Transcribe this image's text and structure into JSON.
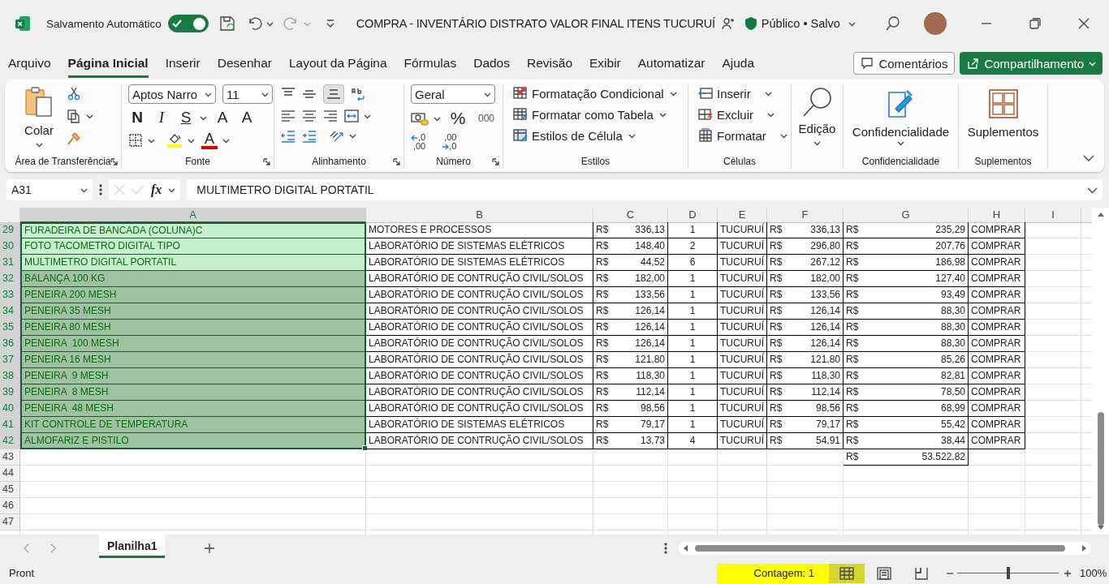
{
  "title_bar": {
    "autosave_label": "Salvamento Automático",
    "autosave_on": true,
    "redo_disabled": true,
    "title": "COMPRA - INVENTÁRIO DISTRATO VALOR FINAL ITENS TUCURUÍ",
    "status": "Público • Salvo"
  },
  "tabs": [
    {
      "label": "Arquivo",
      "selected": false
    },
    {
      "label": "Página Inicial",
      "selected": true
    },
    {
      "label": "Inserir",
      "selected": false
    },
    {
      "label": "Desenhar",
      "selected": false
    },
    {
      "label": "Layout da Página",
      "selected": false
    },
    {
      "label": "Fórmulas",
      "selected": false
    },
    {
      "label": "Dados",
      "selected": false
    },
    {
      "label": "Revisão",
      "selected": false
    },
    {
      "label": "Exibir",
      "selected": false
    },
    {
      "label": "Automatizar",
      "selected": false
    },
    {
      "label": "Ajuda",
      "selected": false
    }
  ],
  "comments_button": "Comentários",
  "share_button": "Compartilhamento",
  "ribbon": {
    "groups": [
      {
        "kind": "clipboard",
        "label": "Área de Transferência",
        "paste": "Colar"
      },
      {
        "kind": "font",
        "label": "Fonte",
        "font_name": "Aptos Narro",
        "font_size": "11",
        "bold": "N",
        "italic": "I",
        "underline": "S",
        "grow": "A",
        "shrink": "A",
        "font_color": "A"
      },
      {
        "kind": "alignment",
        "label": "Alinhamento"
      },
      {
        "kind": "number",
        "label": "Número",
        "format": "Geral",
        "percent": "%",
        "thousands": "000",
        "add_decimal": [
          ",0",
          ",00"
        ],
        "remove_decimal": [
          ",00",
          ",0"
        ]
      },
      {
        "kind": "styles",
        "label": "Estilos",
        "items": [
          "Formatação Condicional",
          "Formatar como Tabela",
          "Estilos de Célula"
        ]
      },
      {
        "kind": "cells",
        "label": "Células",
        "items": [
          "Inserir",
          "Excluir",
          "Formatar"
        ]
      },
      {
        "kind": "editing",
        "button": "Edição"
      },
      {
        "kind": "sensitivity",
        "label": "Confidencialidade",
        "button": "Confidencialidade"
      },
      {
        "kind": "addins",
        "label": "Suplementos",
        "button": "Suplementos"
      }
    ]
  },
  "formula_bar": {
    "name_box": "A31",
    "fx": "fx",
    "formula": "MULTIMETRO DIGITAL PORTATIL"
  },
  "sheet": {
    "columns": [
      {
        "label": "A",
        "selected": true
      },
      {
        "label": "B",
        "selected": false
      },
      {
        "label": "C",
        "selected": false
      },
      {
        "label": "D",
        "selected": false
      },
      {
        "label": "E",
        "selected": false
      },
      {
        "label": "F",
        "selected": false
      },
      {
        "label": "G",
        "selected": false
      },
      {
        "label": "H",
        "selected": false
      },
      {
        "label": "I",
        "selected": false
      }
    ],
    "rows": [
      {
        "number": "29",
        "selected": true,
        "cells": [
          {
            "text": "FURADEIRA DE BANCADA (COLUNA)C",
            "color": "#c6efce"
          },
          {
            "text": "MOTORES E PROCESSOS"
          },
          {
            "currency": "R$",
            "amount": "336,13"
          },
          {
            "text": "1"
          },
          {
            "text": "TUCURUÍ"
          },
          {
            "currency": "R$",
            "amount": "336,13"
          },
          {
            "currency": "R$",
            "amount": "235,29"
          },
          {
            "text": "COMPRAR"
          }
        ]
      },
      {
        "number": "30",
        "selected": true,
        "cells": [
          {
            "text": "FOTO TACOMETRO DIGITAL TIPO",
            "color": "#c6efce"
          },
          {
            "text": "LABORATÓRIO DE SISTEMAS ELÉTRICOS"
          },
          {
            "currency": "R$",
            "amount": "148,40"
          },
          {
            "text": "2"
          },
          {
            "text": "TUCURUÍ"
          },
          {
            "currency": "R$",
            "amount": "296,80"
          },
          {
            "currency": "R$",
            "amount": "207,76"
          },
          {
            "text": "COMPRAR"
          }
        ]
      },
      {
        "number": "31",
        "selected": true,
        "cells": [
          {
            "text": "MULTIMETRO DIGITAL PORTATIL",
            "color": "#c6efce"
          },
          {
            "text": "LABORATÓRIO DE SISTEMAS ELÉTRICOS"
          },
          {
            "currency": "R$",
            "amount": "44,52"
          },
          {
            "text": "6"
          },
          {
            "text": "TUCURUÍ"
          },
          {
            "currency": "R$",
            "amount": "267,12"
          },
          {
            "currency": "R$",
            "amount": "186,98"
          },
          {
            "text": "COMPRAR"
          }
        ]
      },
      {
        "number": "32",
        "selected": true,
        "cells": [
          {
            "text": "BALANÇA 100 KG",
            "color": "#9fc2a2"
          },
          {
            "text": "LABORATÓRIO DE CONTRUÇÃO CIVIL/SOLOS"
          },
          {
            "currency": "R$",
            "amount": "182,00"
          },
          {
            "text": "1"
          },
          {
            "text": "TUCURUÍ"
          },
          {
            "currency": "R$",
            "amount": "182,00"
          },
          {
            "currency": "R$",
            "amount": "127,40"
          },
          {
            "text": "COMPRAR"
          }
        ]
      },
      {
        "number": "33",
        "selected": true,
        "cells": [
          {
            "text": "PENEIRA 200 MESH",
            "color": "#9fc2a2"
          },
          {
            "text": "LABORATÓRIO DE CONTRUÇÃO CIVIL/SOLOS"
          },
          {
            "currency": "R$",
            "amount": "133,56"
          },
          {
            "text": "1"
          },
          {
            "text": "TUCURUÍ"
          },
          {
            "currency": "R$",
            "amount": "133,56"
          },
          {
            "currency": "R$",
            "amount": "93,49"
          },
          {
            "text": "COMPRAR"
          }
        ]
      },
      {
        "number": "34",
        "selected": true,
        "cells": [
          {
            "text": "PENEIRA 35 MESH",
            "color": "#9fc2a2"
          },
          {
            "text": "LABORATÓRIO DE CONTRUÇÃO CIVIL/SOLOS"
          },
          {
            "currency": "R$",
            "amount": "126,14"
          },
          {
            "text": "1"
          },
          {
            "text": "TUCURUÍ"
          },
          {
            "currency": "R$",
            "amount": "126,14"
          },
          {
            "currency": "R$",
            "amount": "88,30"
          },
          {
            "text": "COMPRAR"
          }
        ]
      },
      {
        "number": "35",
        "selected": true,
        "cells": [
          {
            "text": "PENEIRA 80 MESH",
            "color": "#9fc2a2"
          },
          {
            "text": "LABORATÓRIO DE CONTRUÇÃO CIVIL/SOLOS"
          },
          {
            "currency": "R$",
            "amount": "126,14"
          },
          {
            "text": "1"
          },
          {
            "text": "TUCURUÍ"
          },
          {
            "currency": "R$",
            "amount": "126,14"
          },
          {
            "currency": "R$",
            "amount": "88,30"
          },
          {
            "text": "COMPRAR"
          }
        ]
      },
      {
        "number": "36",
        "selected": true,
        "cells": [
          {
            "text": "PENEIRA  100 MESH",
            "color": "#9fc2a2"
          },
          {
            "text": "LABORATÓRIO DE CONTRUÇÃO CIVIL/SOLOS"
          },
          {
            "currency": "R$",
            "amount": "126,14"
          },
          {
            "text": "1"
          },
          {
            "text": "TUCURUÍ"
          },
          {
            "currency": "R$",
            "amount": "126,14"
          },
          {
            "currency": "R$",
            "amount": "88,30"
          },
          {
            "text": "COMPRAR"
          }
        ]
      },
      {
        "number": "37",
        "selected": true,
        "cells": [
          {
            "text": "PENEIRA 16 MESH",
            "color": "#9fc2a2"
          },
          {
            "text": "LABORATÓRIO DE CONTRUÇÃO CIVIL/SOLOS"
          },
          {
            "currency": "R$",
            "amount": "121,80"
          },
          {
            "text": "1"
          },
          {
            "text": "TUCURUÍ"
          },
          {
            "currency": "R$",
            "amount": "121,80"
          },
          {
            "currency": "R$",
            "amount": "85,26"
          },
          {
            "text": "COMPRAR"
          }
        ]
      },
      {
        "number": "38",
        "selected": true,
        "cells": [
          {
            "text": "PENEIRA  9 MESH",
            "color": "#9fc2a2"
          },
          {
            "text": "LABORATÓRIO DE CONTRUÇÃO CIVIL/SOLOS"
          },
          {
            "currency": "R$",
            "amount": "118,30"
          },
          {
            "text": "1"
          },
          {
            "text": "TUCURUÍ"
          },
          {
            "currency": "R$",
            "amount": "118,30"
          },
          {
            "currency": "R$",
            "amount": "82,81"
          },
          {
            "text": "COMPRAR"
          }
        ]
      },
      {
        "number": "39",
        "selected": true,
        "cells": [
          {
            "text": "PENEIRA  8 MESH",
            "color": "#9fc2a2"
          },
          {
            "text": "LABORATÓRIO DE CONTRUÇÃO CIVIL/SOLOS"
          },
          {
            "currency": "R$",
            "amount": "112,14"
          },
          {
            "text": "1"
          },
          {
            "text": "TUCURUÍ"
          },
          {
            "currency": "R$",
            "amount": "112,14"
          },
          {
            "currency": "R$",
            "amount": "78,50"
          },
          {
            "text": "COMPRAR"
          }
        ]
      },
      {
        "number": "40",
        "selected": true,
        "cells": [
          {
            "text": "PENEIRA  48 MESH",
            "color": "#9fc2a2"
          },
          {
            "text": "LABORATÓRIO DE CONTRUÇÃO CIVIL/SOLOS"
          },
          {
            "currency": "R$",
            "amount": "98,56"
          },
          {
            "text": "1"
          },
          {
            "text": "TUCURUÍ"
          },
          {
            "currency": "R$",
            "amount": "98,56"
          },
          {
            "currency": "R$",
            "amount": "68,99"
          },
          {
            "text": "COMPRAR"
          }
        ]
      },
      {
        "number": "41",
        "selected": true,
        "cells": [
          {
            "text": "KIT CONTROLE DE TEMPERATURA",
            "color": "#9fc2a2"
          },
          {
            "text": "LABORATÓRIO DE SISTEMAS ELÉTRICOS"
          },
          {
            "currency": "R$",
            "amount": "79,17"
          },
          {
            "text": "1"
          },
          {
            "text": "TUCURUÍ"
          },
          {
            "currency": "R$",
            "amount": "79,17"
          },
          {
            "currency": "R$",
            "amount": "55,42"
          },
          {
            "text": "COMPRAR"
          }
        ]
      },
      {
        "number": "42",
        "selected": true,
        "cells": [
          {
            "text": "ALMOFARIZ E PISTILO",
            "color": "#9fc2a2"
          },
          {
            "text": "LABORATÓRIO DE CONTRUÇÃO CIVIL/SOLOS"
          },
          {
            "currency": "R$",
            "amount": "13,73"
          },
          {
            "text": "4"
          },
          {
            "text": "TUCURUÍ"
          },
          {
            "currency": "R$",
            "amount": "54,91"
          },
          {
            "currency": "R$",
            "amount": "38,44"
          },
          {
            "text": "COMPRAR"
          }
        ]
      },
      {
        "number": "43",
        "selected": false,
        "cells": [
          null,
          null,
          null,
          null,
          null,
          null,
          {
            "currency": "R$",
            "amount": "53.522,82"
          }
        ]
      },
      {
        "number": "44",
        "selected": false
      },
      {
        "number": "45",
        "selected": false
      },
      {
        "number": "46",
        "selected": false
      },
      {
        "number": "47",
        "selected": false
      }
    ]
  },
  "sheet_tabs": [
    {
      "label": "Planilha1",
      "selected": true
    }
  ],
  "status_bar": {
    "mode": "Pront",
    "count": "Contagem: 1",
    "views": [
      {
        "kind": "normal",
        "selected": true
      },
      {
        "kind": "page_layout",
        "selected": false
      },
      {
        "kind": "page_break",
        "selected": false
      }
    ],
    "zoom": {
      "level": 0.5
    },
    "zoom_label": "100%"
  }
}
